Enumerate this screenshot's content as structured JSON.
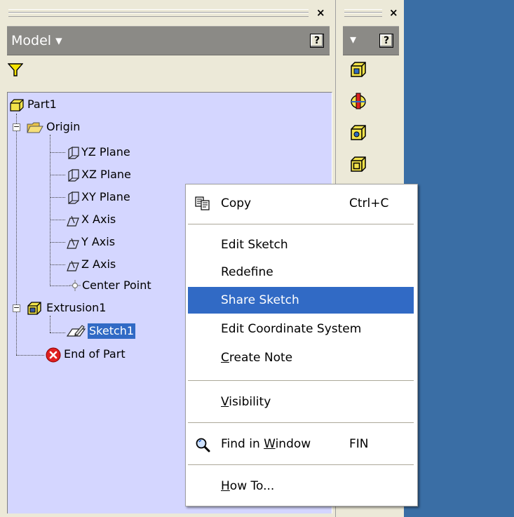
{
  "model_panel": {
    "title": "Model ▾",
    "help": "?",
    "close": "×"
  },
  "tool_panel": {
    "menu_arrow": "▾",
    "help": "?",
    "close": "×"
  },
  "tree": {
    "part": "Part1",
    "origin": "Origin",
    "yz_plane": "YZ Plane",
    "xz_plane": "XZ Plane",
    "xy_plane": "XY Plane",
    "x_axis": "X Axis",
    "y_axis": "Y Axis",
    "z_axis": "Z Axis",
    "center_point": "Center Point",
    "extrusion": "Extrusion1",
    "sketch": "Sketch1",
    "end_of_part": "End of Part"
  },
  "context_menu": {
    "copy": "Copy",
    "copy_shortcut": "Ctrl+C",
    "edit_sketch": "Edit Sketch",
    "redefine": "Redefine",
    "share_sketch": "Share Sketch",
    "edit_coordinate_system": "Edit Coordinate System",
    "create_note_u": "C",
    "create_note_rest": "reate Note",
    "visibility_u": "V",
    "visibility_rest": "isibility",
    "find_in_window_pre": "Find in ",
    "find_in_window_u": "W",
    "find_in_window_rest": "indow",
    "find_shortcut": "FIN",
    "how_to_u": "H",
    "how_to_rest": "ow To..."
  },
  "colors": {
    "tree_background": "#d4d6ff",
    "selection": "#316ac5",
    "panel_header": "#8b8a86",
    "desktop": "#3a6ea5"
  }
}
